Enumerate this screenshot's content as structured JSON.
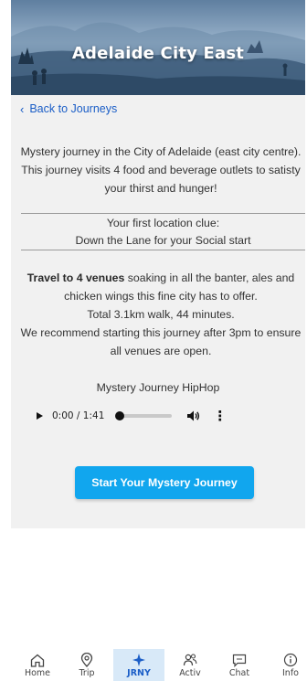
{
  "header": {
    "title": "Adelaide City East"
  },
  "nav": {
    "back_label": "Back to Journeys"
  },
  "description": "Mystery journey in the City of Adelaide (east city centre). This journey visits 4 food and beverage outlets to satisty your thirst and hunger!",
  "clue": {
    "heading": "Your first location clue:",
    "text": "Down the Lane for your Social start"
  },
  "venues": {
    "bold": "Travel to 4 venues",
    "rest": " soaking in all the banter, ales and chicken wings this fine city has to offer.",
    "walk": "Total 3.1km walk, 44 minutes.",
    "recommend": "We recommend starting this journey after 3pm to ensure all venues are open."
  },
  "audio": {
    "title": "Mystery Journey HipHop",
    "time": "0:00 / 1:41",
    "progress": 0
  },
  "cta_label": "Start Your Mystery Journey",
  "tabs": [
    {
      "label": "Home",
      "icon": "home-icon"
    },
    {
      "label": "Trip",
      "icon": "location-pin-icon"
    },
    {
      "label": "JRNY",
      "icon": "compass-star-icon",
      "active": true
    },
    {
      "label": "Activ",
      "icon": "people-icon"
    },
    {
      "label": "Chat",
      "icon": "chat-bubble-icon"
    },
    {
      "label": "Info",
      "icon": "info-icon"
    }
  ],
  "colors": {
    "accent": "#11a6ee",
    "link": "#1b5ec7",
    "panel": "#f1f1f1",
    "tab_active_bg": "#d8e9f8"
  }
}
